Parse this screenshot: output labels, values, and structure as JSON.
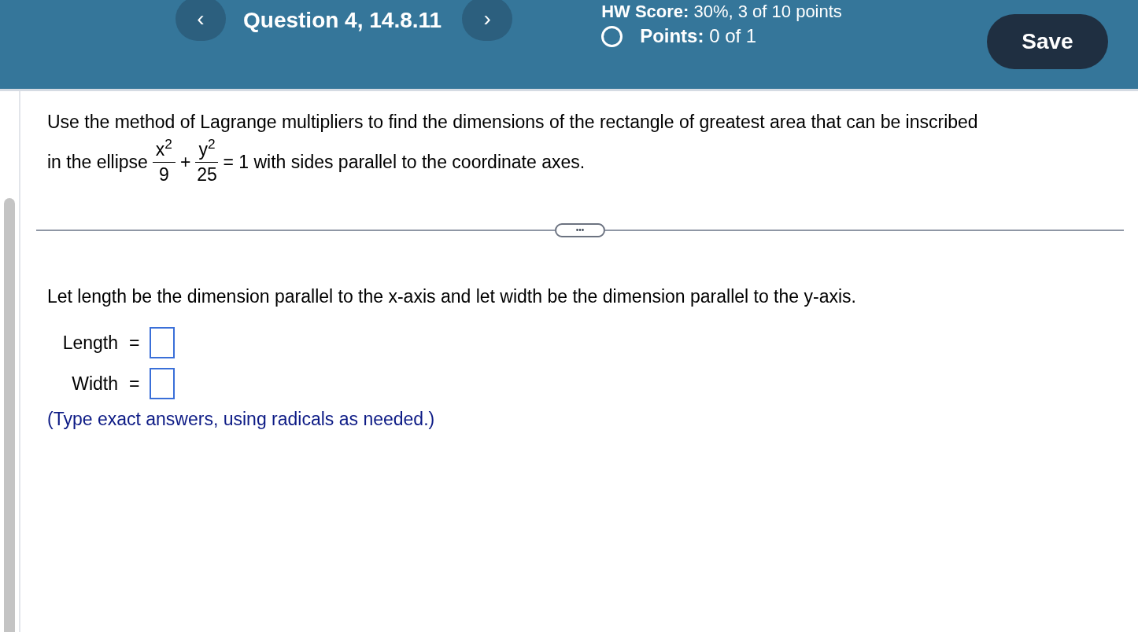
{
  "header": {
    "prev_icon": "‹",
    "title": "Question 4, 14.8.11",
    "next_icon": "›",
    "hw_score_label": "HW Score:",
    "hw_score_value": "30%, 3 of 10 points",
    "points_label": "Points:",
    "points_value": "0 of 1",
    "save_button": "Save"
  },
  "question": {
    "line1": "Use the method of Lagrange multipliers to find the dimensions of the rectangle of greatest area that can be inscribed",
    "line2_before": "in the ellipse",
    "fraction_1": {
      "numerator": "x$^{2}$",
      "denominator": "9"
    },
    "operator": "+",
    "fraction_2": {
      "numerator": "y$^{2}$",
      "denominator": "25"
    },
    "line2_after": "= 1 with sides parallel to the coordinate axes."
  },
  "expand_button": "•••",
  "instruction": "Let length be the dimension parallel to the x-axis and let width be the dimension parallel to the y-axis.",
  "answers": [
    {
      "label": "Length",
      "equals": "="
    },
    {
      "label": "Width",
      "equals": "="
    }
  ],
  "hint": "(Type exact answers, using radicals as needed.)"
}
